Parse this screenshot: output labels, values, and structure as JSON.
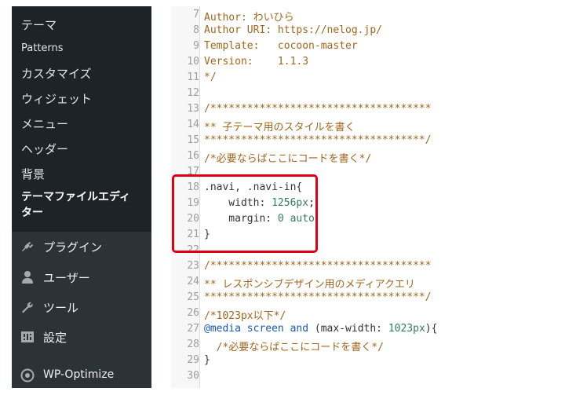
{
  "sidebar": {
    "submenu": [
      {
        "label": "テーマ",
        "current": false
      },
      {
        "label": "Patterns",
        "current": false
      },
      {
        "label": "カスタマイズ",
        "current": false
      },
      {
        "label": "ウィジェット",
        "current": false
      },
      {
        "label": "メニュー",
        "current": false
      },
      {
        "label": "ヘッダー",
        "current": false
      },
      {
        "label": "背景",
        "current": false
      },
      {
        "label": "テーマファイルエディター",
        "current": true
      }
    ],
    "menu": [
      {
        "label": "プラグイン",
        "icon": "plug-icon"
      },
      {
        "label": "ユーザー",
        "icon": "user-icon"
      },
      {
        "label": "ツール",
        "icon": "wrench-icon"
      },
      {
        "label": "設定",
        "icon": "settings-icon"
      },
      {
        "label": "WP-Optimize",
        "icon": "wp-optimize-icon"
      }
    ]
  },
  "editor": {
    "lines": [
      {
        "n": "7",
        "text": "Author: わいひら"
      },
      {
        "n": "8",
        "text": "Author URI: https://nelog.jp/"
      },
      {
        "n": "9",
        "text": "Template:   cocoon-master"
      },
      {
        "n": "10",
        "text": "Version:    1.1.3"
      },
      {
        "n": "11",
        "text": "*/"
      },
      {
        "n": "12",
        "text": ""
      },
      {
        "n": "13",
        "text": "/************************************"
      },
      {
        "n": "14",
        "text": "** 子テーマ用のスタイルを書く"
      },
      {
        "n": "15",
        "text": "************************************/"
      },
      {
        "n": "16",
        "text": "/*必要ならばここにコードを書く*/"
      },
      {
        "n": "17",
        "text": ""
      },
      {
        "n": "18",
        "text": ".navi, .navi-in{"
      },
      {
        "n": "19",
        "text": "    width: 1256px;"
      },
      {
        "n": "20",
        "text": "    margin: 0 auto"
      },
      {
        "n": "21",
        "text": "}"
      },
      {
        "n": "22",
        "text": ""
      },
      {
        "n": "23",
        "text": "/************************************"
      },
      {
        "n": "24",
        "text": "** レスポンシブデザイン用のメディアクエリ"
      },
      {
        "n": "25",
        "text": "************************************/"
      },
      {
        "n": "26",
        "text": "/*1023px以下*/"
      },
      {
        "n": "27",
        "text": "@media screen and (max-width: 1023px){"
      },
      {
        "n": "28",
        "text": "  /*必要ならばここにコードを書く*/"
      },
      {
        "n": "29",
        "text": "}"
      },
      {
        "n": "30",
        "text": ""
      }
    ]
  },
  "colors": {
    "sidebar_bg": "#2c3338",
    "submenu_bg": "#1d2327",
    "comment": "#a0661c",
    "keyword": "#1a57b5",
    "number": "#2f7d5a",
    "highlight": "#e00013"
  }
}
